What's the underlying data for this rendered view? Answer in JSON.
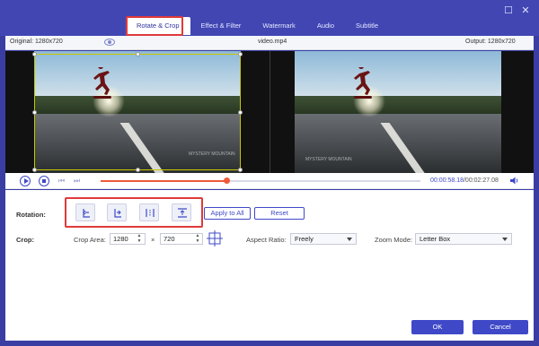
{
  "window": {
    "minimize_glyph": "☐",
    "close_glyph": "✕"
  },
  "tabs": [
    {
      "label": "Rotate & Crop",
      "active": true
    },
    {
      "label": "Effect & Filter",
      "active": false
    },
    {
      "label": "Watermark",
      "active": false
    },
    {
      "label": "Audio",
      "active": false
    },
    {
      "label": "Subtitle",
      "active": false
    }
  ],
  "preview": {
    "original_label": "Original: 1280x720",
    "filename": "video.mp4",
    "output_label": "Output: 1280x720",
    "watermark_text": "MYSTERY MOUNTAIN"
  },
  "playback": {
    "current_time": "00:00:58.18",
    "total_time": "/00:02:27.08",
    "progress": 0.396
  },
  "rotation": {
    "label": "Rotation:",
    "buttons": [
      "rotate-left",
      "rotate-right",
      "flip-horizontal",
      "flip-vertical"
    ],
    "apply_all_label": "Apply to All",
    "reset_label": "Reset"
  },
  "crop": {
    "label": "Crop:",
    "area_label": "Crop Area:",
    "width": "1280",
    "times": "×",
    "height": "720",
    "aspect_label": "Aspect Ratio:",
    "aspect_value": "Freely",
    "zoom_label": "Zoom Mode:",
    "zoom_value": "Letter Box"
  },
  "footer": {
    "ok_label": "OK",
    "cancel_label": "Cancel"
  },
  "colors": {
    "accent": "#3f49c8",
    "highlight": "#e03a3a",
    "progress": "#ef5a38"
  }
}
